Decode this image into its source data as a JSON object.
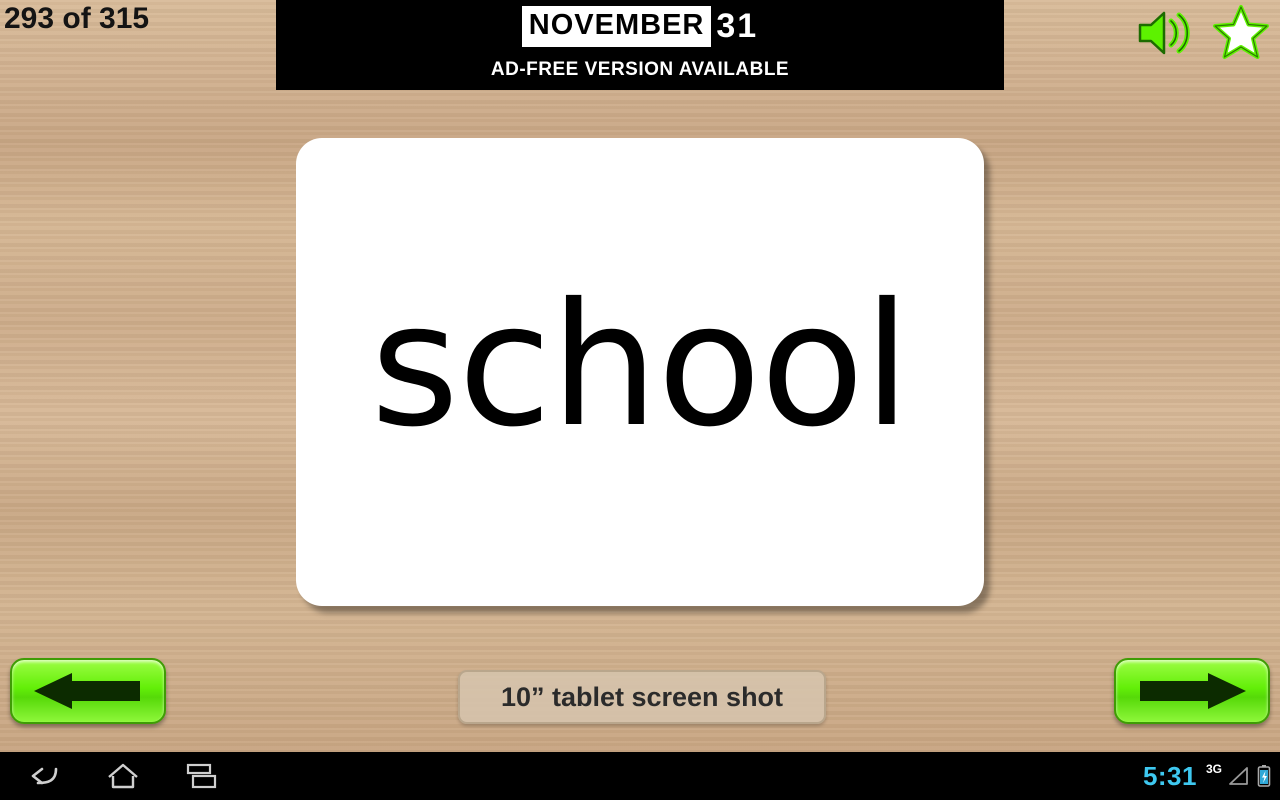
{
  "app": {
    "counter": "293 of 315",
    "card_word": "school",
    "caption": "10” tablet screen shot"
  },
  "ad": {
    "title_part1": "NOVEMBER",
    "title_part2": "31",
    "subtitle": "AD-FREE VERSION AVAILABLE"
  },
  "controls": {
    "sound_icon": "speaker-sound-icon",
    "star_icon": "star-favorite-icon",
    "prev_label": "previous-card",
    "next_label": "next-card"
  },
  "system_bar": {
    "back_icon": "back-arrow-icon",
    "home_icon": "home-icon",
    "recents_icon": "recent-apps-icon",
    "clock": "5:31",
    "network": "3G",
    "signal_icon": "signal-bars-icon",
    "battery_icon": "battery-charging-icon"
  },
  "colors": {
    "background": "#cdac8a",
    "button_green": "#63ef08",
    "card_white": "#ffffff",
    "clock_blue": "#3ec8f0"
  }
}
